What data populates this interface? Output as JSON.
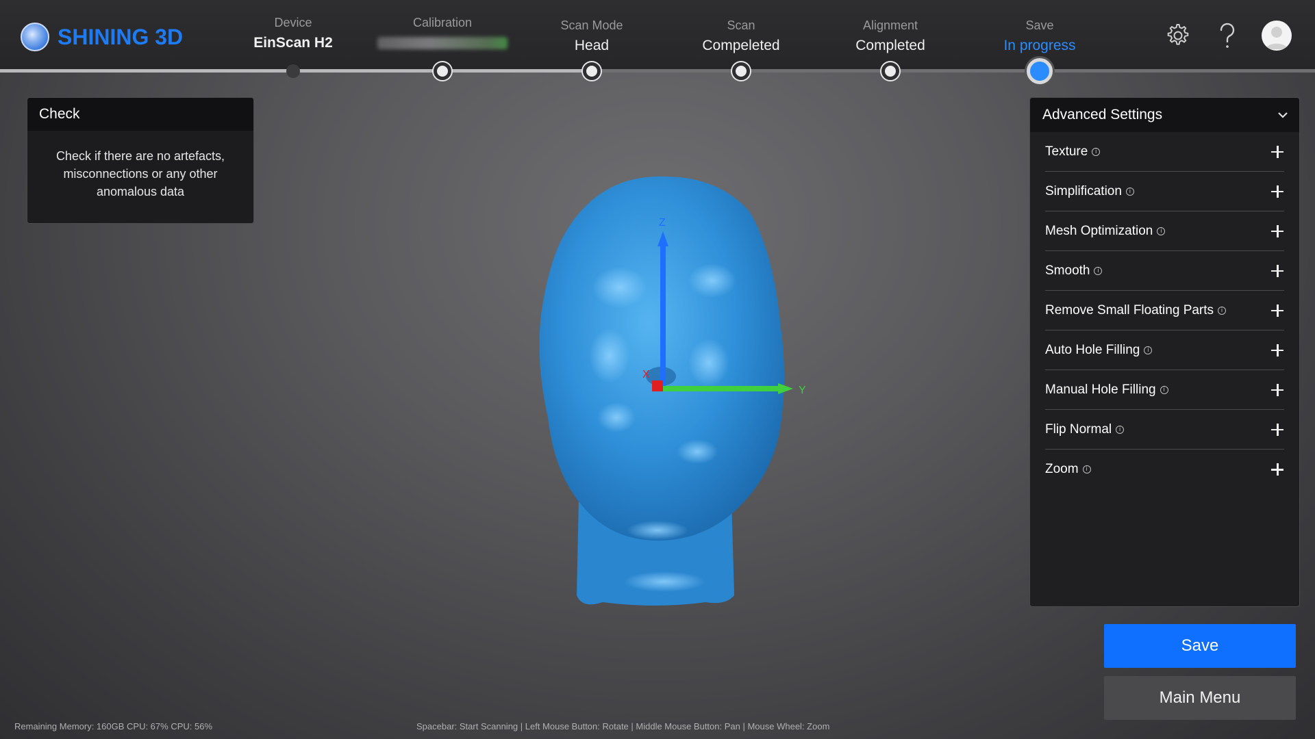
{
  "app": {
    "brand": "SHINING 3D"
  },
  "steps": [
    {
      "label": "Device",
      "value": "EinScan H2"
    },
    {
      "label": "Calibration",
      "value": ""
    },
    {
      "label": "Scan Mode",
      "value": "Head"
    },
    {
      "label": "Scan",
      "value": "Compeleted"
    },
    {
      "label": "Alignment",
      "value": "Completed"
    },
    {
      "label": "Save",
      "value": "In progress"
    }
  ],
  "icons": {
    "settings": "gear-icon",
    "help": "question-mark-icon",
    "user": "user-avatar-icon",
    "logo": "shining3d-logo-icon"
  },
  "check_panel": {
    "title": "Check",
    "body": "Check if there are no artefacts, misconnections or any other anomalous data"
  },
  "viewport": {
    "axis_x": "X",
    "axis_y": "Y",
    "axis_z": "Z"
  },
  "advanced_settings": {
    "title": "Advanced Settings",
    "items": [
      {
        "label": "Texture"
      },
      {
        "label": "Simplification"
      },
      {
        "label": "Mesh Optimization"
      },
      {
        "label": "Smooth"
      },
      {
        "label": "Remove Small Floating Parts"
      },
      {
        "label": "Auto Hole Filling"
      },
      {
        "label": "Manual Hole Filling"
      },
      {
        "label": "Flip Normal"
      },
      {
        "label": "Zoom"
      }
    ]
  },
  "buttons": {
    "save": "Save",
    "main_menu": "Main Menu"
  },
  "status": {
    "system": "Remaining Memory: 160GB CPU: 67% CPU: 56%",
    "shortcuts": "Spacebar: Start Scanning  |  Left Mouse Button: Rotate  |  Middle Mouse Button: Pan  |  Mouse Wheel: Zoom"
  },
  "colors": {
    "accent": "#0f6fff",
    "brand": "#1f7bf2",
    "model": "#2f8fd8",
    "axis_x": "#e02020",
    "axis_y": "#3fcf3f",
    "axis_z": "#1f6fff"
  }
}
